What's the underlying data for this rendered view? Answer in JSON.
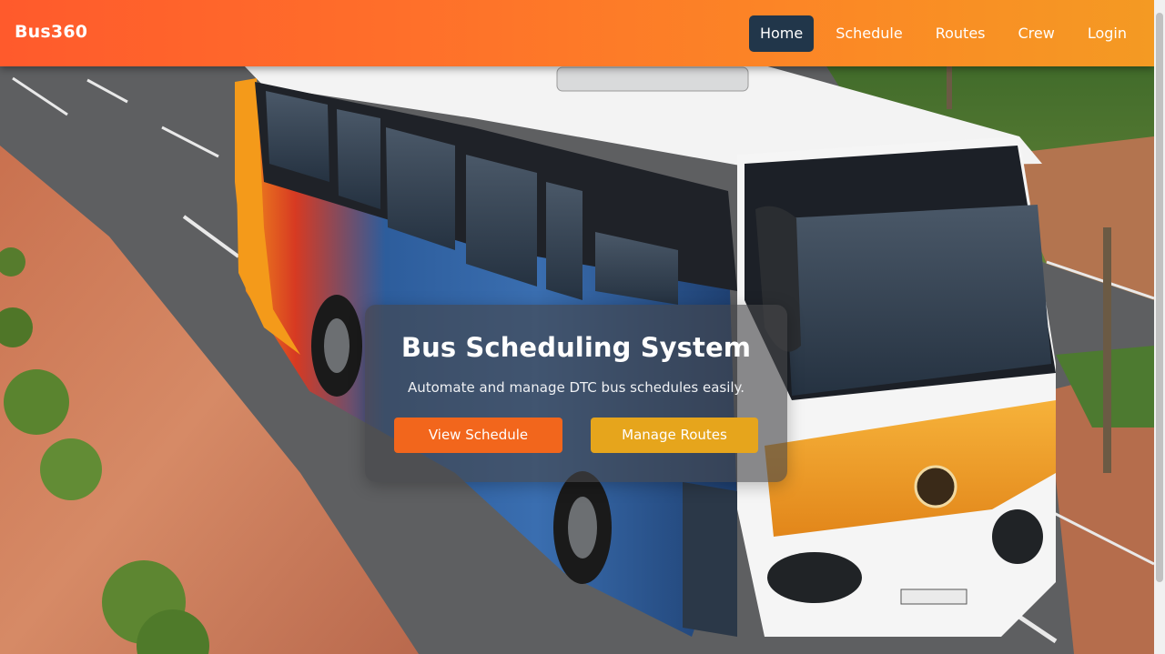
{
  "brand": "Bus360",
  "nav": {
    "items": [
      {
        "label": "Home",
        "active": true
      },
      {
        "label": "Schedule",
        "active": false
      },
      {
        "label": "Routes",
        "active": false
      },
      {
        "label": "Crew",
        "active": false
      },
      {
        "label": "Login",
        "active": false
      }
    ]
  },
  "hero": {
    "title": "Bus Scheduling System",
    "subtitle": "Automate and manage DTC bus schedules easily.",
    "primary_button": "View Schedule",
    "secondary_button": "Manage Routes"
  },
  "colors": {
    "navbar_start": "#ff5a2c",
    "navbar_end": "#f49a23",
    "active_nav": "#21364a",
    "primary_button": "#f2661c",
    "secondary_button": "#e6a51c"
  }
}
